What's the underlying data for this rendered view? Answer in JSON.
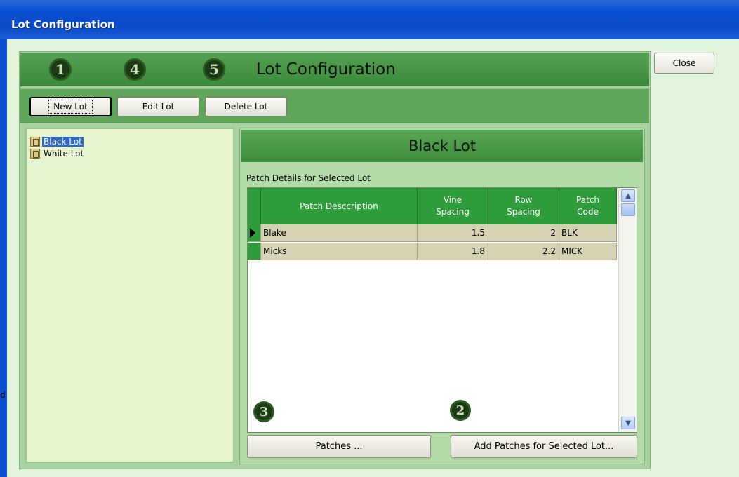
{
  "window": {
    "title": "Lot Configuration"
  },
  "stray_text": "d",
  "close_button": {
    "label": "Close"
  },
  "header": {
    "title": "Lot Configuration",
    "badges": [
      "1",
      "4",
      "5"
    ]
  },
  "toolbar": {
    "new_lot": "New Lot",
    "edit_lot": "Edit Lot",
    "delete_lot": "Delete Lot"
  },
  "tree": {
    "items": [
      {
        "label": "Black Lot",
        "selected": true,
        "icon": "lot-icon"
      },
      {
        "label": "White Lot",
        "selected": false,
        "icon": "lot-icon"
      }
    ]
  },
  "detail": {
    "title": "Black Lot",
    "subtitle": "Patch Details for Selected Lot",
    "columns": {
      "description": "Patch Desccription",
      "vine_spacing": "Vine Spacing",
      "row_spacing": "Row Spacing",
      "patch_code": "Patch Code"
    },
    "rows": [
      {
        "description": "Blake",
        "vine_spacing": "1.5",
        "row_spacing": "2",
        "patch_code": "BLK",
        "current": true
      },
      {
        "description": "Micks",
        "vine_spacing": "1.8",
        "row_spacing": "2.2",
        "patch_code": "MICK",
        "current": false
      }
    ],
    "badges": [
      "3",
      "2"
    ],
    "patches_button": "Patches ...",
    "add_patches_button": "Add Patches for Selected Lot..."
  },
  "colors": {
    "titlebar": "#0b4cc8",
    "panel_green": "#3b8a3a",
    "grid_header": "#2f9c3c",
    "selection": "#316ac5"
  }
}
